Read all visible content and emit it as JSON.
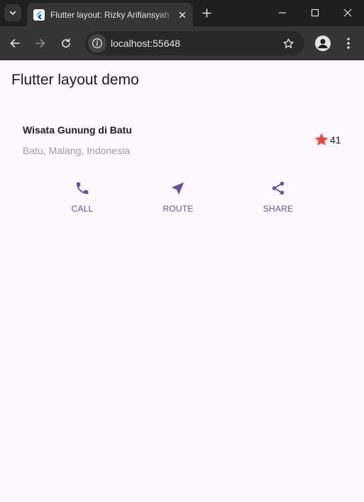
{
  "browser": {
    "tab_title": "Flutter layout: Rizky Arifiansyah",
    "url": "localhost:55648",
    "window_controls": [
      "minimize-icon",
      "maximize-icon",
      "close-icon"
    ]
  },
  "app": {
    "title": "Flutter layout demo",
    "place": {
      "name": "Wisata Gunung di Batu",
      "location": "Batu, Malang, Indonesia",
      "rating_count": "41",
      "star_color": "#f44336"
    },
    "actions": [
      {
        "label": "CALL",
        "icon": "phone-icon"
      },
      {
        "label": "ROUTE",
        "icon": "near-me-icon"
      },
      {
        "label": "SHARE",
        "icon": "share-icon"
      }
    ],
    "accent_color": "#6750a4"
  }
}
